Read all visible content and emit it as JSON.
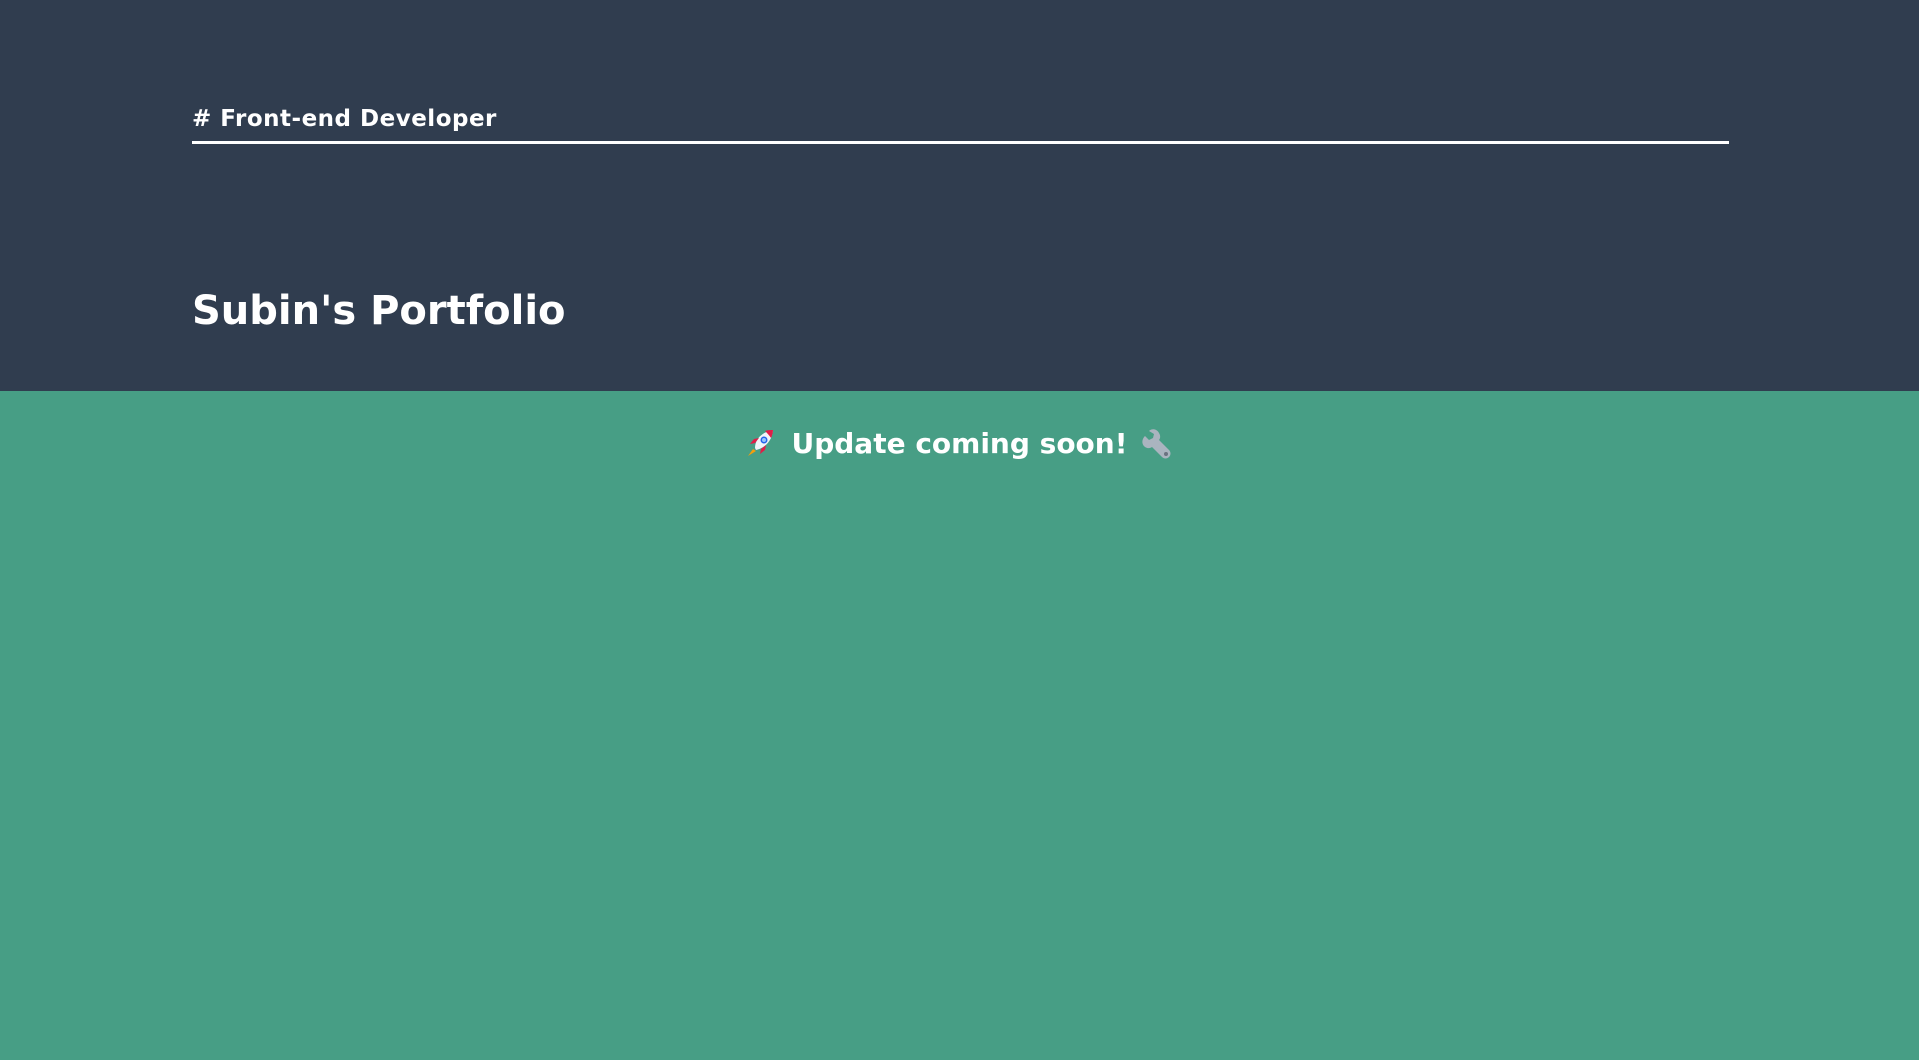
{
  "header": {
    "subtitle": "# Front-end Developer",
    "title": "Subin's Portfolio"
  },
  "content": {
    "notice": "Update coming soon!",
    "leading_icon": "rocket-icon",
    "trailing_icon": "wrench-icon"
  },
  "colors": {
    "header_background": "#303d4f",
    "content_background": "#479e85",
    "text": "#ffffff"
  }
}
